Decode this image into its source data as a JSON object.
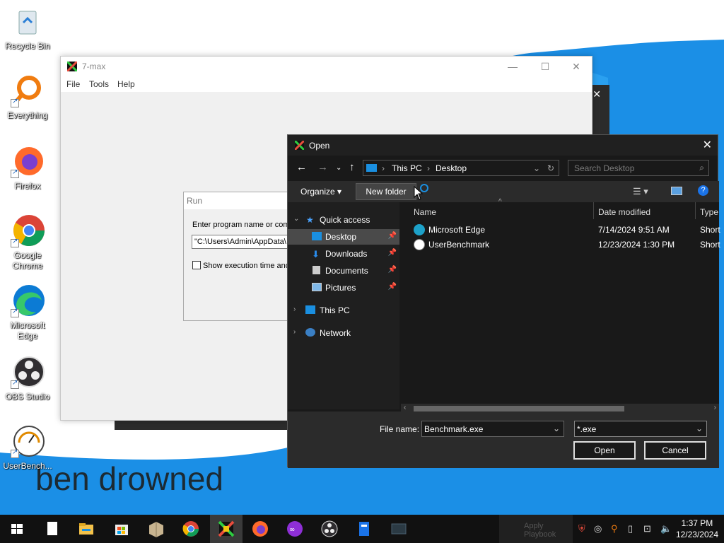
{
  "desktop": {
    "wallpaper_text": "ben drowned",
    "icons": [
      {
        "label": "Recycle Bin"
      },
      {
        "label": "Everything"
      },
      {
        "label": "Firefox"
      },
      {
        "label": "Google Chrome"
      },
      {
        "label": "Microsoft Edge"
      },
      {
        "label": "OBS Studio"
      },
      {
        "label": "UserBench..."
      }
    ]
  },
  "app_window": {
    "title": "7-max",
    "menu": [
      "File",
      "Tools",
      "Help"
    ]
  },
  "run_dialog": {
    "title": "Run",
    "prompt": "Enter program name or comm",
    "input_value": "\"C:\\Users\\Admin\\AppData\\",
    "checkbox_label": "Show execution time and"
  },
  "open_dialog": {
    "title": "Open",
    "breadcrumb": [
      "This PC",
      "Desktop"
    ],
    "search_placeholder": "Search Desktop",
    "toolbar": {
      "organize": "Organize",
      "new_folder": "New folder"
    },
    "nav": {
      "quick_access": "Quick access",
      "desktop": "Desktop",
      "downloads": "Downloads",
      "documents": "Documents",
      "pictures": "Pictures",
      "this_pc": "This PC",
      "network": "Network"
    },
    "columns": {
      "name": "Name",
      "date": "Date modified",
      "type": "Type"
    },
    "files": [
      {
        "name": "Microsoft Edge",
        "date": "7/14/2024 9:51 AM",
        "type": "Short"
      },
      {
        "name": "UserBenchmark",
        "date": "12/23/2024 1:30 PM",
        "type": "Short"
      }
    ],
    "file_name_label": "File name:",
    "file_name_value": "Benchmark.exe",
    "file_type_value": "*.exe",
    "open_button": "Open",
    "cancel_button": "Cancel"
  },
  "taskbar": {
    "ghost_label": "Apply Playbook",
    "time": "1:37 PM",
    "date": "12/23/2024"
  }
}
